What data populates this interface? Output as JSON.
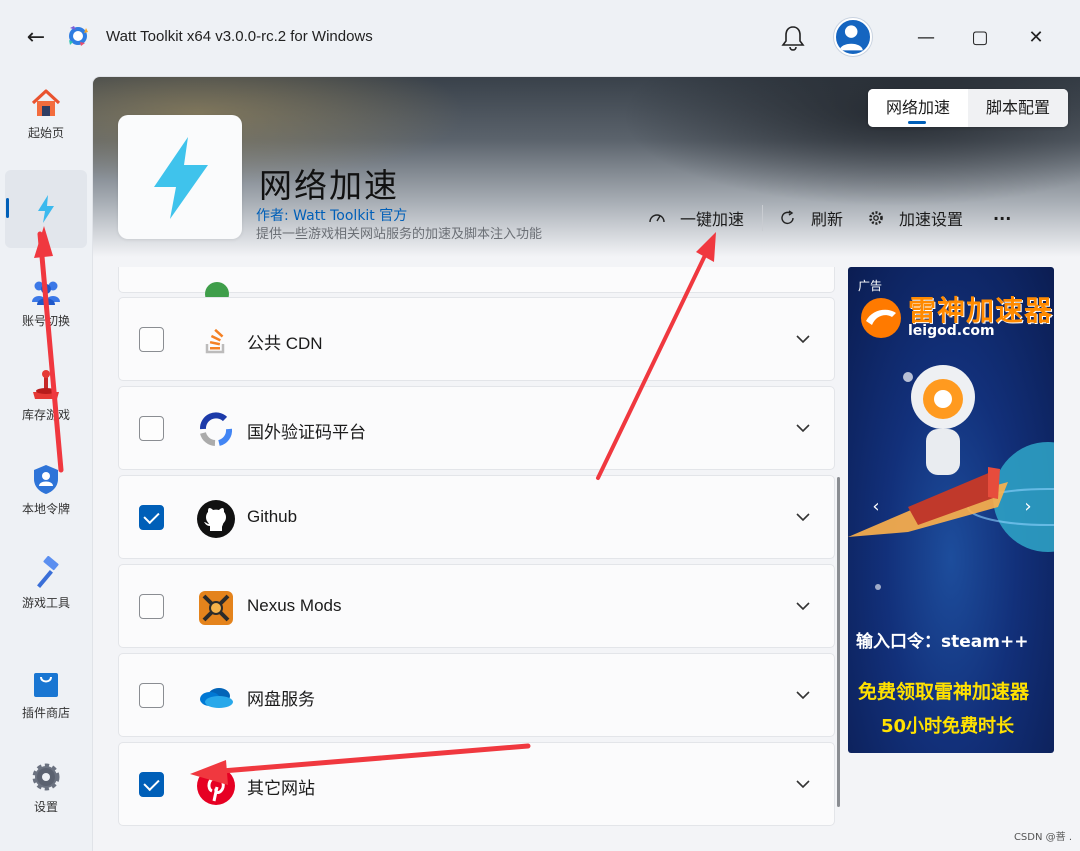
{
  "window": {
    "title": "Watt Toolkit x64 v3.0.0-rc.2 for Windows",
    "back_icon": "←",
    "minimize": "—",
    "maximize": "▢",
    "close": "✕"
  },
  "sidebar": {
    "items": [
      {
        "label": "起始页",
        "icon": "home-icon"
      },
      {
        "label": "",
        "icon": "lightning-icon"
      },
      {
        "label": "账号切换",
        "icon": "users-icon"
      },
      {
        "label": "库存游戏",
        "icon": "joystick-icon"
      },
      {
        "label": "本地令牌",
        "icon": "shield-user-icon"
      },
      {
        "label": "游戏工具",
        "icon": "hammer-icon"
      },
      {
        "label": "插件商店",
        "icon": "shopping-bag-icon"
      },
      {
        "label": "设置",
        "icon": "gear-icon"
      }
    ]
  },
  "tabs": [
    {
      "label": "网络加速"
    },
    {
      "label": "脚本配置"
    }
  ],
  "plugin": {
    "title": "网络加速",
    "author": "作者:  Watt Toolkit  官方",
    "description": "提供一些游戏相关网站服务的加速及脚本注入功能"
  },
  "actions": {
    "accelerate": "一键加速",
    "refresh": "刷新",
    "settings": "加速设置",
    "more": "···"
  },
  "services": [
    {
      "label": "公共 CDN",
      "checked": false,
      "icon": "stackoverflow-icon"
    },
    {
      "label": "国外验证码平台",
      "checked": false,
      "icon": "recaptcha-icon"
    },
    {
      "label": "Github",
      "checked": true,
      "icon": "github-icon"
    },
    {
      "label": "Nexus Mods",
      "checked": false,
      "icon": "nexus-mods-icon"
    },
    {
      "label": "网盘服务",
      "checked": false,
      "icon": "onedrive-icon"
    },
    {
      "label": "其它网站",
      "checked": true,
      "icon": "pinterest-icon"
    }
  ],
  "ad": {
    "tag": "广告",
    "brand": "雷神加速器",
    "domain": "leigod.com",
    "code_line": "输入口令：steam++",
    "promo_line1": "免费领取雷神加速器",
    "promo_line2": "50小时免费时长",
    "prev": "‹",
    "next": "›"
  },
  "watermark": "CSDN @菩 .",
  "colors": {
    "accent": "#005fb8",
    "annotation_arrow": "#f0383f"
  }
}
